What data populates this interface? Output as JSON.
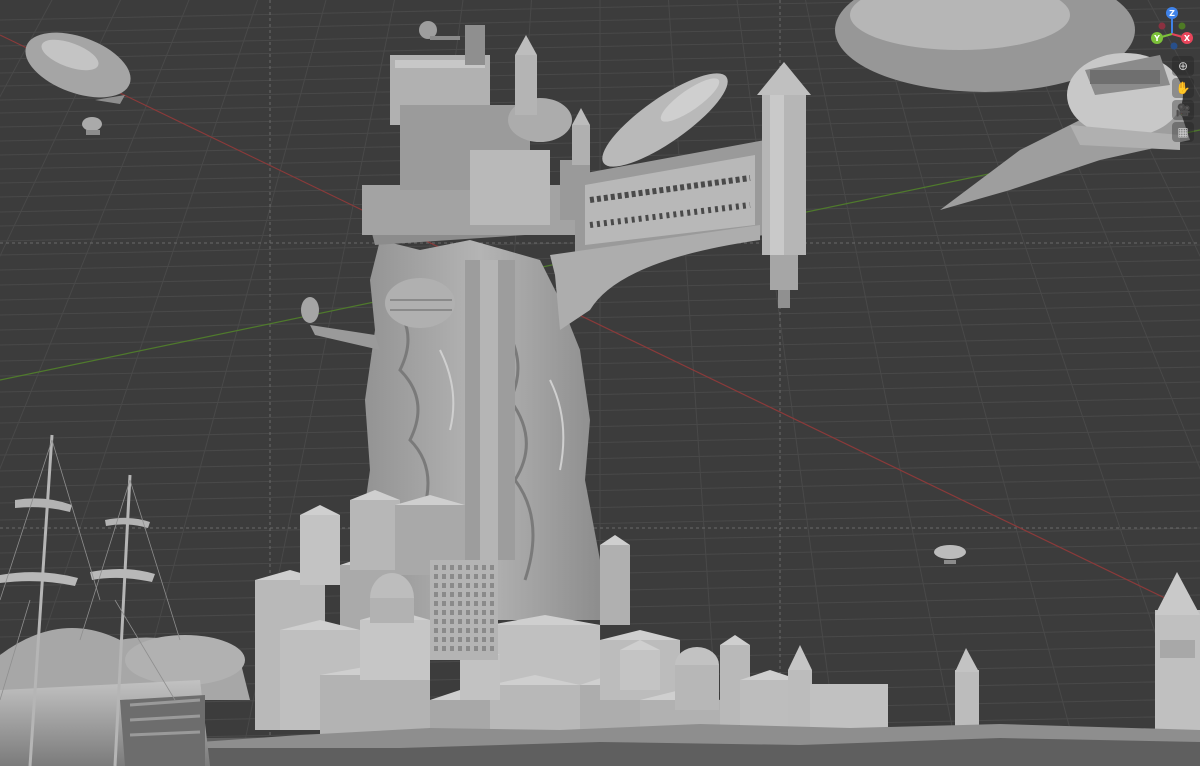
{
  "viewport": {
    "background": "#3c3c3c",
    "grid_color": "#484848",
    "x_axis_color": "#8a3a3a",
    "y_axis_color": "#4f7a2c",
    "model_color": "#a9a9a9"
  },
  "gizmo": {
    "axes": [
      {
        "name": "Z",
        "color": "#3f82e8"
      },
      {
        "name": "Y",
        "color": "#7cc13a"
      },
      {
        "name": "X",
        "color": "#e8455b"
      }
    ]
  },
  "nav_buttons": [
    {
      "name": "zoom",
      "icon": "magnifier-plus-icon",
      "glyph": "⊕"
    },
    {
      "name": "pan",
      "icon": "hand-icon",
      "glyph": "✋"
    },
    {
      "name": "camera",
      "icon": "camera-icon",
      "glyph": "🎥"
    },
    {
      "name": "perspective",
      "icon": "perspective-grid-icon",
      "glyph": "▦"
    }
  ]
}
